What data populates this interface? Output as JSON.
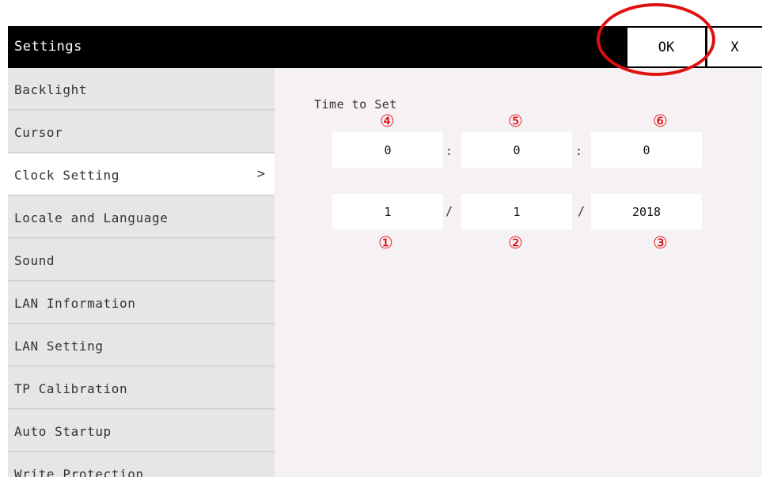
{
  "window": {
    "title": "Settings",
    "ok_label": "OK",
    "close_label": "X"
  },
  "sidebar": {
    "items": [
      {
        "label": "Backlight"
      },
      {
        "label": "Cursor"
      },
      {
        "label": "Clock Setting",
        "chevron": ">"
      },
      {
        "label": "Locale and Language"
      },
      {
        "label": "Sound"
      },
      {
        "label": "LAN Information"
      },
      {
        "label": "LAN Setting"
      },
      {
        "label": "TP Calibration"
      },
      {
        "label": "Auto Startup"
      },
      {
        "label": "Write Protection"
      }
    ]
  },
  "clock": {
    "section_label": "Time to Set",
    "time": {
      "hour": "0",
      "minute": "0",
      "second": "0",
      "separator": ":"
    },
    "date": {
      "month": "1",
      "day": "1",
      "year": "2018",
      "separator": "/"
    }
  },
  "markers": {
    "m1": "①",
    "m2": "②",
    "m3": "③",
    "m4": "④",
    "m5": "⑤",
    "m6": "⑥"
  },
  "annotation": {
    "highlight_color": "#e01010"
  }
}
